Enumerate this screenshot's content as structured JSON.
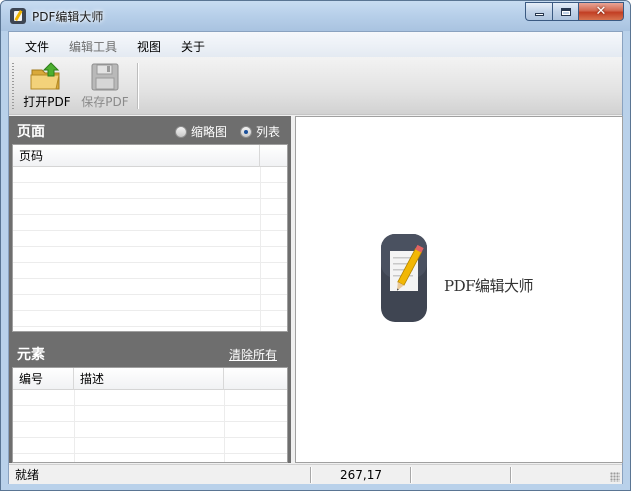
{
  "window": {
    "title": "PDF编辑大师"
  },
  "menu": [
    "文件",
    "编辑工具",
    "视图",
    "关于"
  ],
  "toolbar": {
    "open_label": "打开PDF",
    "save_label": "保存PDF"
  },
  "pages_panel": {
    "title": "页面",
    "view_options": [
      {
        "label": "缩略图",
        "selected": false
      },
      {
        "label": "列表",
        "selected": true
      }
    ],
    "columns": [
      "页码"
    ]
  },
  "elements_panel": {
    "title": "元素",
    "clear_label": "清除所有",
    "columns": [
      "编号",
      "描述"
    ]
  },
  "preview": {
    "logo_text": "PDF编辑大师"
  },
  "status": {
    "text": "就绪",
    "coords": "267,17"
  },
  "colors": {
    "panel_header": "#6e6e6e",
    "titlebar": "#b9d1ea",
    "close_button": "#c23e23"
  }
}
